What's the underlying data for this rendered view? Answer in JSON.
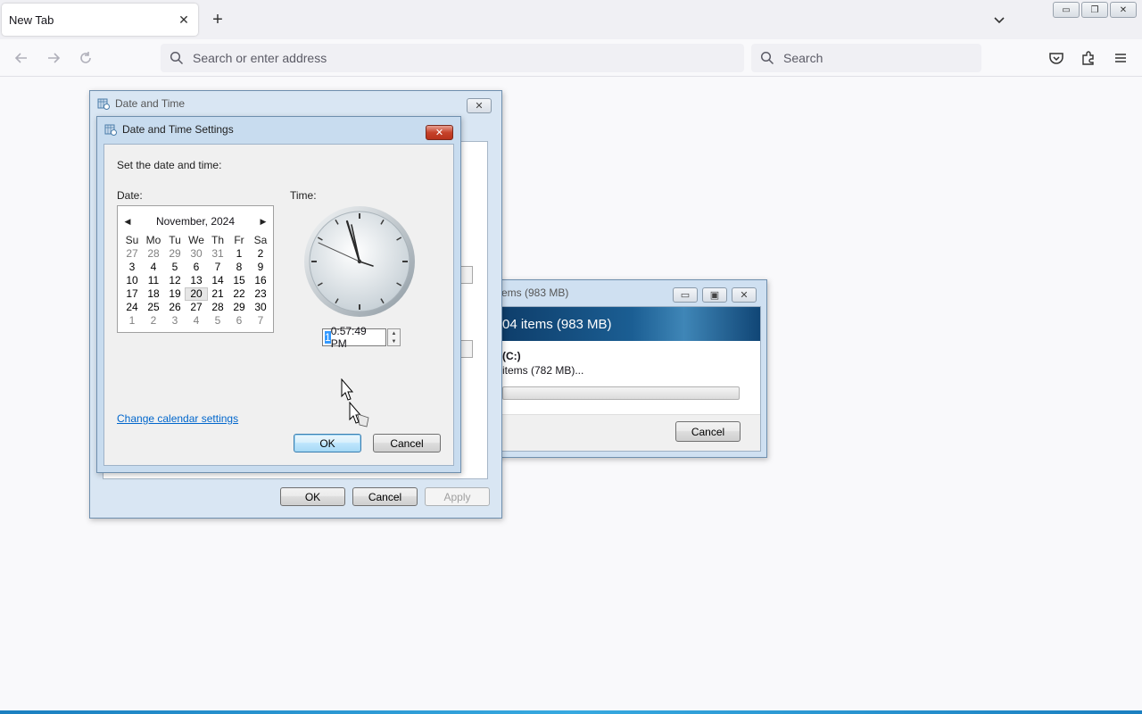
{
  "browser": {
    "tab_title": "New Tab",
    "tab_close": "✕",
    "new_tab": "+",
    "url_placeholder": "Search or enter address",
    "search_placeholder": "Search",
    "window_buttons": [
      "▭",
      "❐",
      "✕"
    ]
  },
  "copy_dialog": {
    "title": "ems (983 MB)",
    "band_text": "04 items (983 MB)",
    "from_label": "(C:)",
    "remaining": "items (782 MB)...",
    "cancel": "Cancel",
    "title_buttons": [
      "▭",
      "▣",
      "✕"
    ]
  },
  "date_time": {
    "title": "Date and Time",
    "ok": "OK",
    "cancel": "Cancel",
    "apply": "Apply"
  },
  "settings": {
    "title": "Date and Time Settings",
    "instruction": "Set the date and time:",
    "date_label": "Date:",
    "time_label": "Time:",
    "month_year": "November, 2024",
    "days_of_week": [
      "Su",
      "Mo",
      "Tu",
      "We",
      "Th",
      "Fr",
      "Sa"
    ],
    "weeks": [
      [
        "27",
        "28",
        "29",
        "30",
        "31",
        "1",
        "2"
      ],
      [
        "3",
        "4",
        "5",
        "6",
        "7",
        "8",
        "9"
      ],
      [
        "10",
        "11",
        "12",
        "13",
        "14",
        "15",
        "16"
      ],
      [
        "17",
        "18",
        "19",
        "20",
        "21",
        "22",
        "23"
      ],
      [
        "24",
        "25",
        "26",
        "27",
        "28",
        "29",
        "30"
      ],
      [
        "1",
        "2",
        "3",
        "4",
        "5",
        "6",
        "7"
      ]
    ],
    "selected_day": "20",
    "time_hour_visible": "1",
    "time_rest": "0:57:49 PM",
    "change_calendar": "Change calendar settings",
    "ok": "OK",
    "cancel": "Cancel"
  },
  "colors": {
    "link": "#0066cc",
    "time_selection": "#3399ff",
    "close_red": "#c6422a"
  }
}
